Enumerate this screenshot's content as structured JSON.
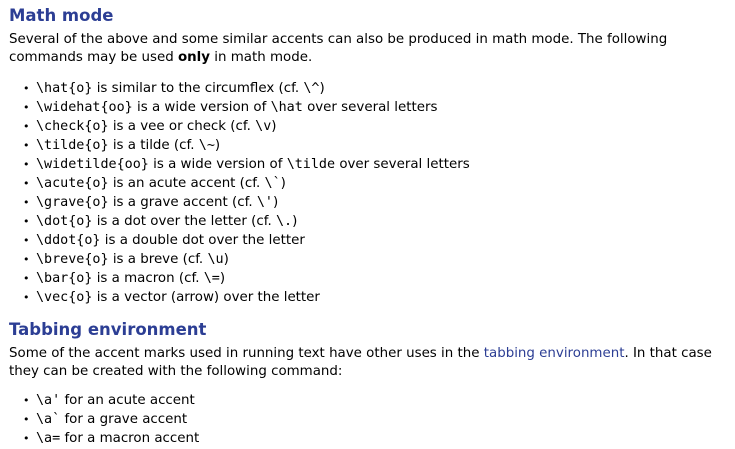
{
  "math": {
    "heading": "Math mode",
    "intro_before": "Several of the above and some similar accents can also be produced in math mode. The following commands may be used ",
    "intro_bold": "only",
    "intro_after": " in math mode.",
    "items": [
      {
        "cmd": "\\hat{o}",
        "text": " is similar to the circumflex (cf. ",
        "ref": "\\^",
        "end": ")"
      },
      {
        "cmd": "\\widehat{oo}",
        "text": " is a wide version of ",
        "ref": "\\hat",
        "end": " over several letters"
      },
      {
        "cmd": "\\check{o}",
        "text": " is a vee or check (cf. ",
        "ref": "\\v",
        "end": ")"
      },
      {
        "cmd": "\\tilde{o}",
        "text": " is a tilde (cf. ",
        "ref": "\\~",
        "end": ")"
      },
      {
        "cmd": "\\widetilde{oo}",
        "text": " is a wide version of ",
        "ref": "\\tilde",
        "end": " over several letters"
      },
      {
        "cmd": "\\acute{o}",
        "text": " is an acute accent (cf. ",
        "ref": "\\`",
        "end": ")"
      },
      {
        "cmd": "\\grave{o}",
        "text": " is a grave accent (cf. ",
        "ref": "\\'",
        "end": ")"
      },
      {
        "cmd": "\\dot{o}",
        "text": " is a dot over the letter (cf. ",
        "ref": "\\.",
        "end": ")"
      },
      {
        "cmd": "\\ddot{o}",
        "text": " is a double dot over the letter",
        "ref": "",
        "end": ""
      },
      {
        "cmd": "\\breve{o}",
        "text": " is a breve (cf. ",
        "ref": "\\u",
        "end": ")"
      },
      {
        "cmd": "\\bar{o}",
        "text": " is a macron (cf. ",
        "ref": "\\=",
        "end": ")"
      },
      {
        "cmd": "\\vec{o}",
        "text": " is a vector (arrow) over the letter",
        "ref": "",
        "end": ""
      }
    ]
  },
  "tabbing": {
    "heading": "Tabbing environment",
    "intro_before": "Some of the accent marks used in running text have other uses in the ",
    "link_text": "tabbing environment",
    "intro_after": ". In that case they can be created with the following command:",
    "items": [
      {
        "cmd": "\\a'",
        "text": " for an acute accent"
      },
      {
        "cmd": "\\a`",
        "text": " for a grave accent"
      },
      {
        "cmd": "\\a=",
        "text": " for a macron accent"
      }
    ]
  },
  "colors": {
    "heading": "#2c3e94",
    "link": "#2c3e94"
  },
  "bullet_glyph": "•"
}
